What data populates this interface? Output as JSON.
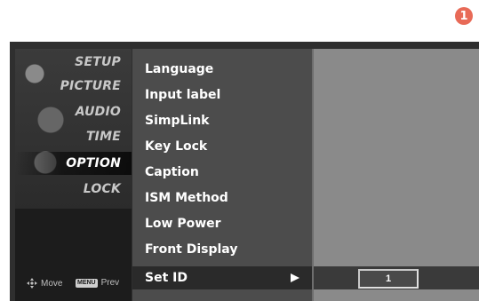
{
  "step_badge": "1",
  "categories": [
    {
      "label": "SETUP"
    },
    {
      "label": "PICTURE"
    },
    {
      "label": "AUDIO"
    },
    {
      "label": "TIME"
    },
    {
      "label": "OPTION",
      "selected": true
    },
    {
      "label": "LOCK"
    }
  ],
  "hints": {
    "move": "Move",
    "menu_key": "MENU",
    "prev": "Prev"
  },
  "menu": {
    "items": [
      {
        "label": "Language"
      },
      {
        "label": "Input label"
      },
      {
        "label": "SimpLink"
      },
      {
        "label": "Key Lock"
      },
      {
        "label": "Caption"
      },
      {
        "label": "ISM Method"
      },
      {
        "label": "Low Power"
      },
      {
        "label": "Front Display"
      },
      {
        "label": "Set ID",
        "selected": true
      }
    ]
  },
  "set_id": {
    "value": "1"
  },
  "icons": {
    "move": "dpad-icon",
    "arrow": "right-triangle-icon"
  }
}
